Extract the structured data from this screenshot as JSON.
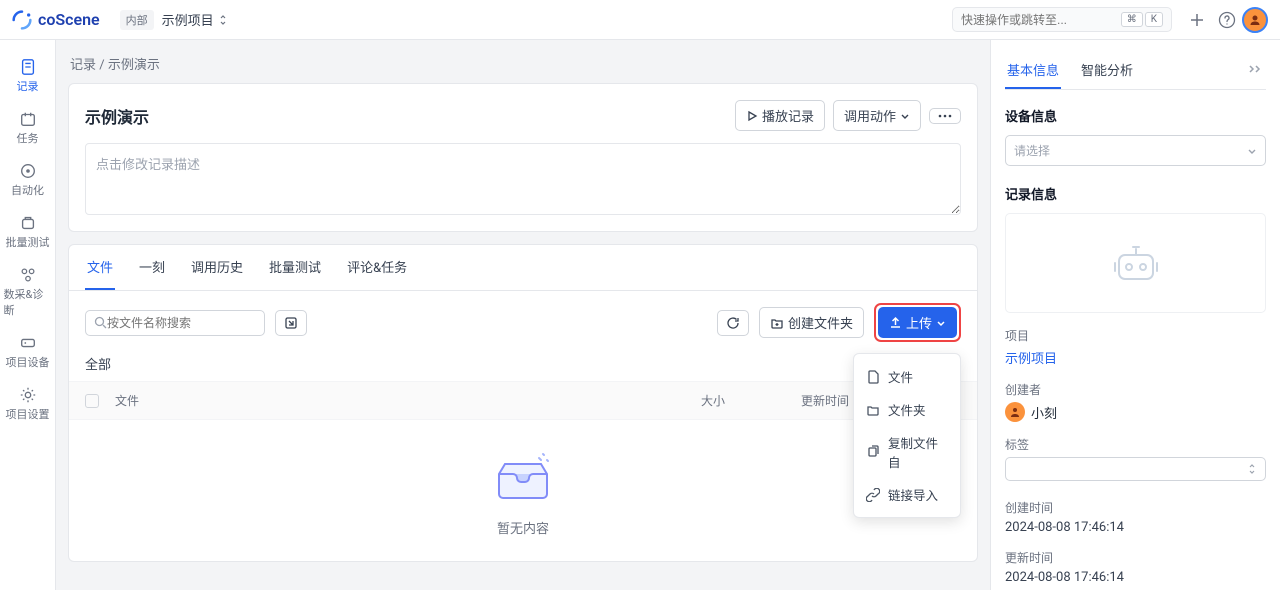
{
  "brand": "coScene",
  "topbar": {
    "internal_tag": "内部",
    "project_name": "示例项目",
    "search_placeholder": "快速操作或跳转至...",
    "kbd1": "⌘",
    "kbd2": "K"
  },
  "sidebar": {
    "items": [
      {
        "label": "记录"
      },
      {
        "label": "任务"
      },
      {
        "label": "自动化"
      },
      {
        "label": "批量测试"
      },
      {
        "label": "数采&诊断"
      },
      {
        "label": "项目设备"
      },
      {
        "label": "项目设置"
      }
    ]
  },
  "breadcrumb": {
    "root": "记录",
    "sep": "/",
    "current": "示例演示"
  },
  "header": {
    "title": "示例演示",
    "play": "播放记录",
    "debug": "调用动作",
    "desc_placeholder": "点击修改记录描述"
  },
  "tabs": [
    {
      "label": "文件"
    },
    {
      "label": "一刻"
    },
    {
      "label": "调用历史"
    },
    {
      "label": "批量测试"
    },
    {
      "label": "评论&任务"
    }
  ],
  "toolbar": {
    "search_placeholder": "按文件名称搜索",
    "create_folder": "创建文件夹",
    "upload": "上传"
  },
  "files": {
    "all": "全部",
    "col_file": "文件",
    "col_size": "大小",
    "col_time": "更新时间",
    "empty": "暂无内容"
  },
  "upload_menu": [
    {
      "label": "文件"
    },
    {
      "label": "文件夹"
    },
    {
      "label": "复制文件自"
    },
    {
      "label": "链接导入"
    }
  ],
  "right": {
    "tab_basic": "基本信息",
    "tab_ai": "智能分析",
    "device_info": "设备信息",
    "device_placeholder": "请选择",
    "record_info": "记录信息",
    "project_label": "项目",
    "project_value": "示例项目",
    "creator_label": "创建者",
    "creator_name": "小刻",
    "tags_label": "标签",
    "created_label": "创建时间",
    "created_value": "2024-08-08 17:46:14",
    "updated_label": "更新时间",
    "updated_value": "2024-08-08 17:46:14"
  }
}
